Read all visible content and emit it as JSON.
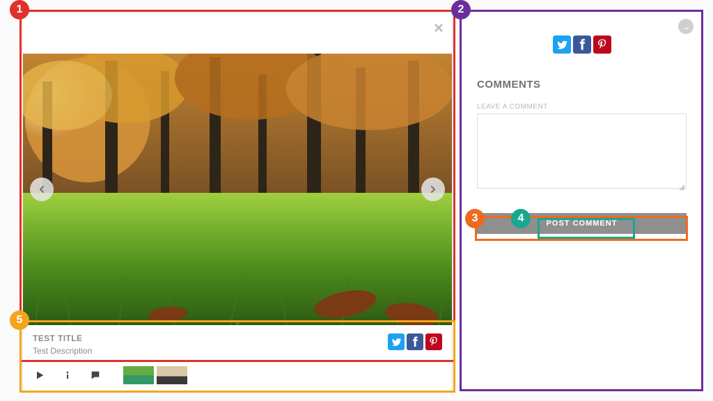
{
  "gallery": {
    "close_glyph": "×",
    "prev_glyph": "‹",
    "next_glyph": "›",
    "caret_glyph": "⌄",
    "title": "TEST TITLE",
    "description": "Test Description"
  },
  "share": {
    "twitter_color": "#1da1f2",
    "facebook_color": "#3b5998",
    "pinterest_color": "#bd081c"
  },
  "sidebar": {
    "arrow_glyph": "→",
    "comments_heading": "COMMENTS",
    "leave_label": "LEAVE A COMMENT",
    "post_button": "POST COMMENT"
  },
  "annotations": {
    "1": {
      "num": "1",
      "color": "#e1312a"
    },
    "2": {
      "num": "2",
      "color": "#6a2e9b"
    },
    "3": {
      "num": "3",
      "color": "#ed6b1f"
    },
    "4": {
      "num": "4",
      "color": "#17a88f"
    },
    "5": {
      "num": "5",
      "color": "#f2a51a"
    }
  }
}
